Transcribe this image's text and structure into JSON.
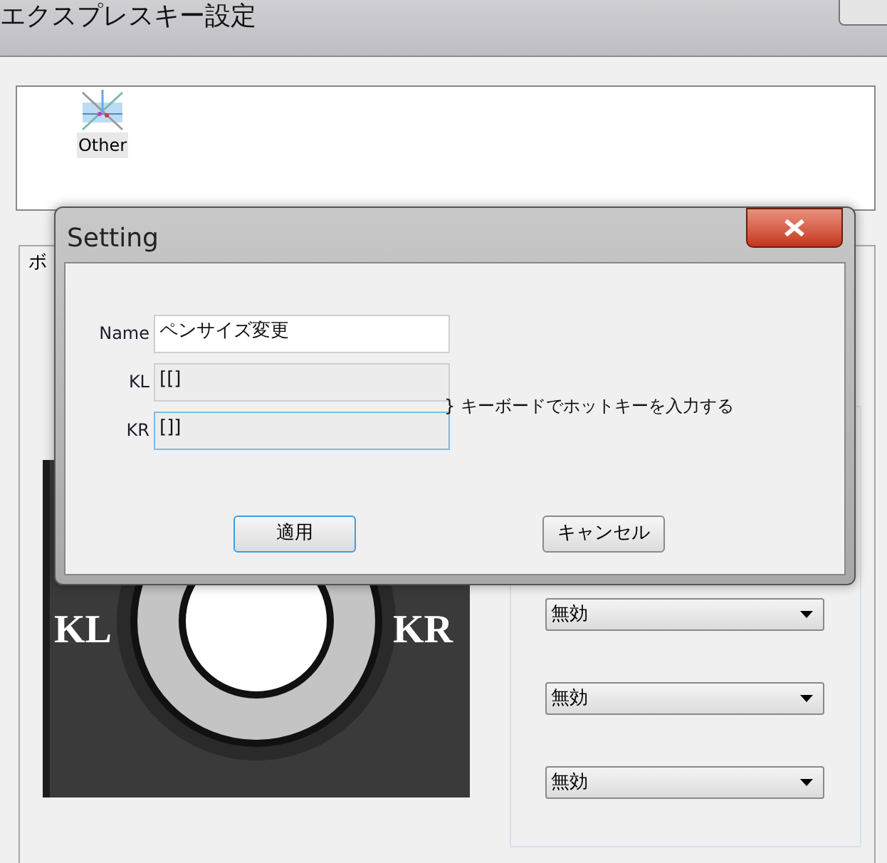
{
  "window": {
    "title": "エクスプレスキー設定"
  },
  "app_list": [
    {
      "label": "Other",
      "selected": true
    }
  ],
  "group": {
    "label": "ボ"
  },
  "device": {
    "left_label": "KL",
    "right_label": "KR"
  },
  "dropdowns": [
    {
      "value": "無効"
    },
    {
      "value": "無効"
    },
    {
      "value": "無効"
    }
  ],
  "dialog": {
    "title": "Setting",
    "fields": [
      {
        "label": "Name",
        "value": "ペンサイズ変更",
        "editable": true,
        "focused": false
      },
      {
        "label": "KL",
        "value": "[[]",
        "editable": false,
        "focused": false
      },
      {
        "label": "KR",
        "value": "[]]",
        "editable": false,
        "focused": true
      }
    ],
    "hint": "} キーボードでホットキーを入力する",
    "buttons": [
      {
        "label": "適用",
        "default": true
      },
      {
        "label": "キャンセル",
        "default": false
      }
    ]
  }
}
